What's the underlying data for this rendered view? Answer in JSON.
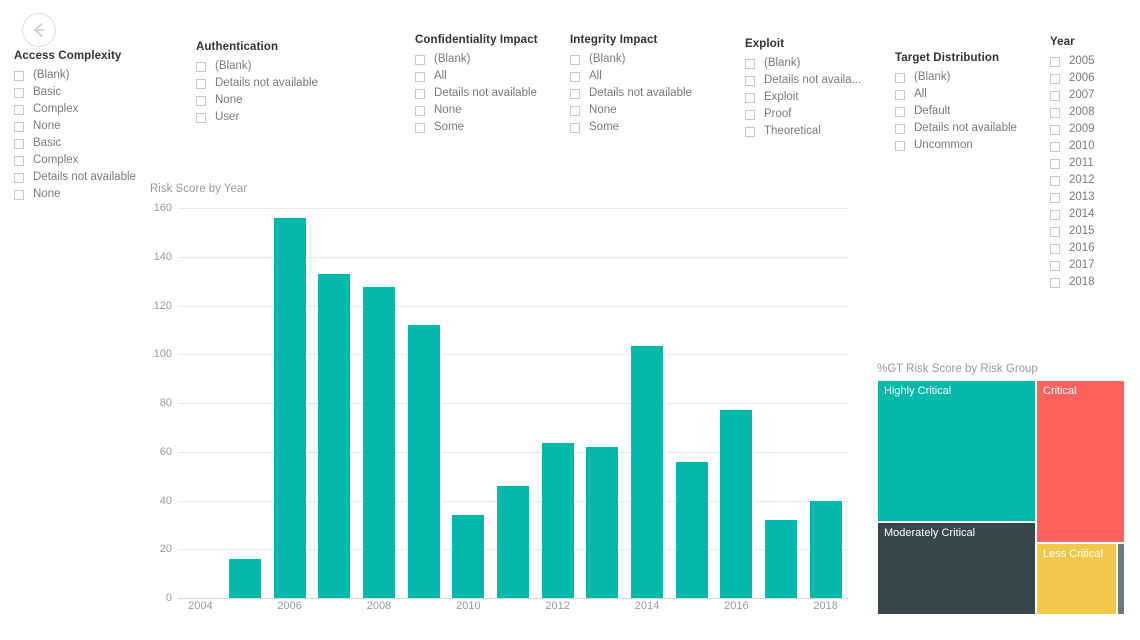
{
  "nav": {
    "back_label": "Back",
    "icon": "arrow-left-circle-icon"
  },
  "slicers": [
    {
      "id": "access-complexity",
      "title": "Access Complexity",
      "items": [
        "(Blank)",
        "Basic",
        "Complex",
        "None",
        "Basic",
        "Complex",
        "Details not available",
        "None"
      ]
    },
    {
      "id": "authentication",
      "title": "Authentication",
      "items": [
        "(Blank)",
        "Details not available",
        "None",
        "User"
      ]
    },
    {
      "id": "confidentiality-impact",
      "title": "Confidentiality Impact",
      "items": [
        "(Blank)",
        "All",
        "Details not available",
        "None",
        "Some"
      ]
    },
    {
      "id": "integrity-impact",
      "title": "Integrity Impact",
      "items": [
        "(Blank)",
        "All",
        "Details not available",
        "None",
        "Some"
      ]
    },
    {
      "id": "exploit",
      "title": "Exploit",
      "items": [
        "(Blank)",
        "Details not availa...",
        "Exploit",
        "Proof",
        "Theoretical"
      ]
    },
    {
      "id": "target-distribution",
      "title": "Target Distribution",
      "items": [
        "(Blank)",
        "All",
        "Default",
        "Details not available",
        "Uncommon"
      ]
    },
    {
      "id": "year",
      "title": "Year",
      "items": [
        "2005",
        "2006",
        "2007",
        "2008",
        "2009",
        "2010",
        "2011",
        "2012",
        "2013",
        "2014",
        "2015",
        "2016",
        "2017",
        "2018"
      ]
    }
  ],
  "colors": {
    "bar": "#01b8aa",
    "highly_critical": "#01b8aa",
    "critical": "#fd625e",
    "moderately_critical": "#374649",
    "less_critical": "#f2c84c",
    "sliver": "#6b7a7d",
    "axis_text": "#999999",
    "gridline": "#e9e9e9"
  },
  "chart_data": [
    {
      "type": "bar",
      "title": "Risk Score by Year",
      "xlabel": "",
      "ylabel": "",
      "categories": [
        2005,
        2006,
        2007,
        2008,
        2009,
        2010,
        2011,
        2012,
        2013,
        2014,
        2015,
        2016,
        2017,
        2018
      ],
      "values": [
        16,
        156,
        133,
        127.5,
        112,
        34,
        46,
        63.5,
        62,
        103.5,
        56,
        77,
        32,
        40
      ],
      "series": [
        {
          "name": "Risk Score",
          "values": [
            16,
            156,
            133,
            127.5,
            112,
            34,
            46,
            63.5,
            62,
            103.5,
            56,
            77,
            32,
            40
          ]
        }
      ],
      "ylim": [
        0,
        160
      ],
      "yticks": [
        0,
        20,
        40,
        60,
        80,
        100,
        120,
        140,
        160
      ],
      "xticks": [
        2004,
        2006,
        2008,
        2010,
        2012,
        2014,
        2016,
        2018
      ],
      "grid": true,
      "legend": "none"
    },
    {
      "type": "treemap",
      "title": "%GT Risk Score by Risk Group",
      "categories": [
        "Highly Critical",
        "Critical",
        "Moderately Critical",
        "Less Critical"
      ],
      "labels": [
        "Highly Critical",
        "Critical",
        "Moderately Critical",
        "Less Critical"
      ],
      "values": [
        33.5,
        27.0,
        27.0,
        11.5
      ],
      "colors": [
        "#01b8aa",
        "#fd625e",
        "#374649",
        "#f2c84c"
      ],
      "legend": "none"
    }
  ]
}
